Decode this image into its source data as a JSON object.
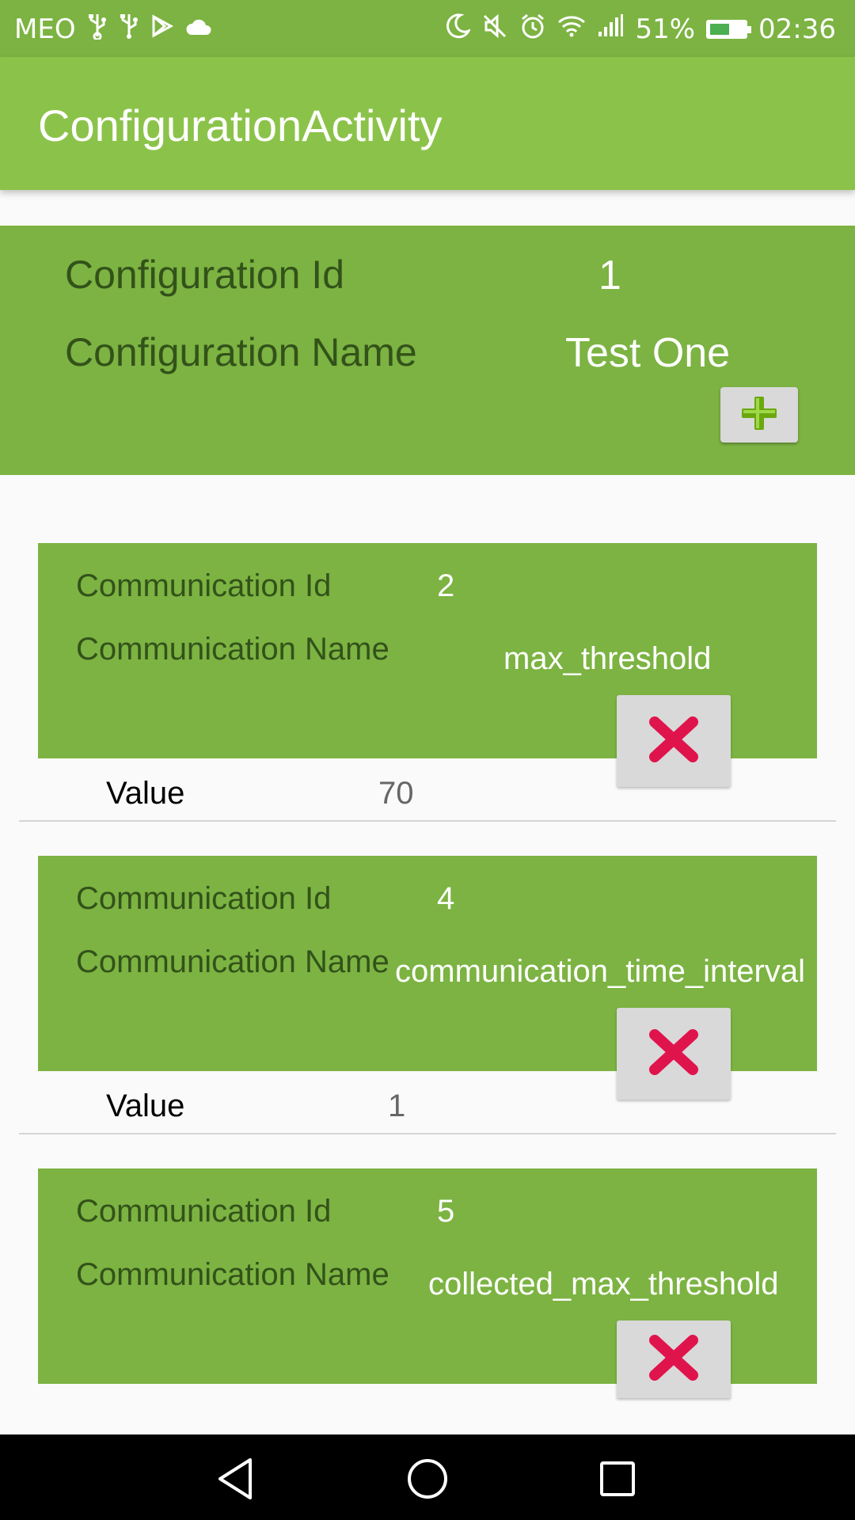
{
  "status_bar": {
    "carrier": "MEO",
    "left_icons": [
      "usb-icon",
      "usb-icon",
      "play-store-icon",
      "cloud-icon"
    ],
    "right_icons": [
      "moon-icon",
      "mute-icon",
      "alarm-icon",
      "wifi-icon",
      "signal-icon"
    ],
    "battery": "51%",
    "time": "02:36"
  },
  "app_bar": {
    "title": "ConfigurationActivity"
  },
  "configuration": {
    "id_label": "Configuration Id",
    "id_value": "1",
    "name_label": "Configuration Name",
    "name_value": "Test One",
    "add_icon": "plus-icon"
  },
  "communications": [
    {
      "id_label": "Communication Id",
      "id": "2",
      "name_label": "Communication Name",
      "name": "max_threshold",
      "value_label": "Value",
      "value": "70"
    },
    {
      "id_label": "Communication Id",
      "id": "4",
      "name_label": "Communication Name",
      "name": "communication_time_interval",
      "value_label": "Value",
      "value": "1"
    },
    {
      "id_label": "Communication Id",
      "id": "5",
      "name_label": "Communication Name",
      "name": "collected_max_threshold"
    }
  ],
  "colors": {
    "status_bar": "#7cb342",
    "app_bar": "#8bc34a",
    "panel": "#7cb342",
    "delete_x": "#e0144c",
    "add_plus": "#6aa80e"
  },
  "nav_bar": {
    "icons": [
      "back-icon",
      "home-icon",
      "recents-icon"
    ]
  }
}
